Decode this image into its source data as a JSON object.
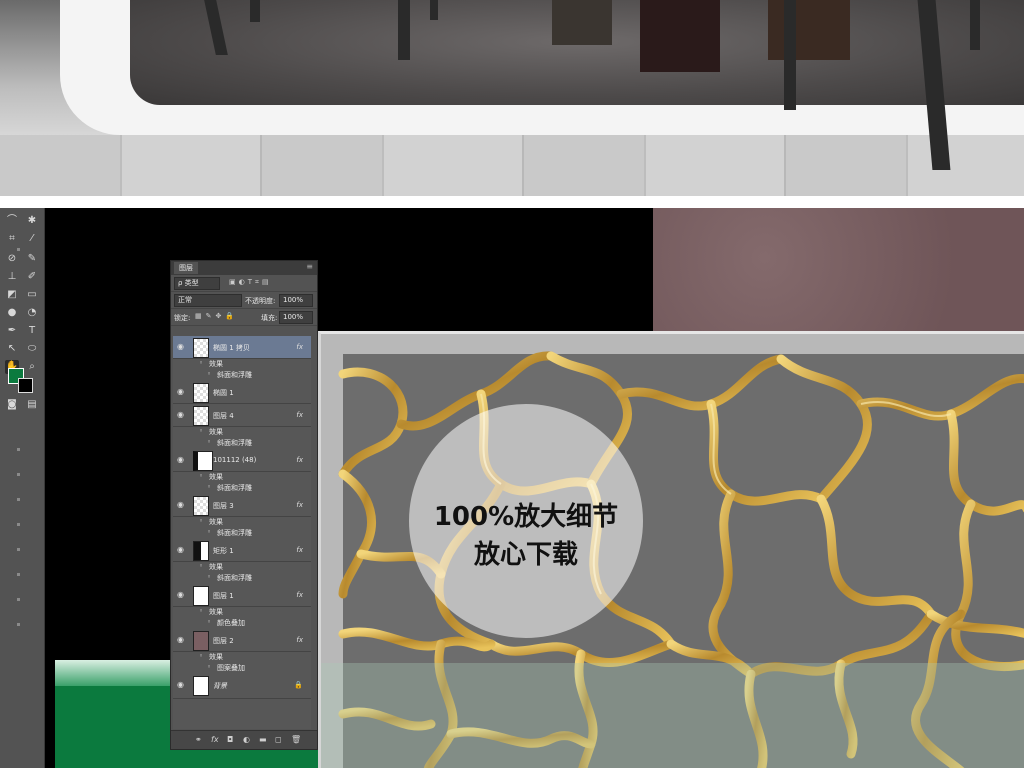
{
  "zoom_callout": {
    "line1": "100%放大细节",
    "line2": "放心下载"
  },
  "layers_panel": {
    "tab_title": "图层",
    "filter_label": "ρ 类型",
    "blend_mode": "正常",
    "opacity_label": "不透明度:",
    "opacity_value": "100%",
    "lock_label": "锁定:",
    "fill_label": "填充:",
    "fill_value": "100%",
    "layers": [
      {
        "name": "椭圆 1 拷贝",
        "fx": "fx",
        "effects_label": "效果",
        "effect": "斜面和浮雕",
        "selected": true
      },
      {
        "name": "椭圆 1"
      },
      {
        "name": "图层 4",
        "fx": "fx",
        "effects_label": "效果",
        "effect": "斜面和浮雕"
      },
      {
        "name": "101112 (48)",
        "fx": "fx",
        "effects_label": "效果",
        "effect": "斜面和浮雕"
      },
      {
        "name": "图层 3",
        "fx": "fx",
        "effects_label": "效果",
        "effect": "斜面和浮雕"
      },
      {
        "name": "矩形 1",
        "fx": "fx",
        "effects_label": "效果",
        "effect": "斜面和浮雕"
      },
      {
        "name": "图层 1",
        "fx": "fx",
        "effects_label": "效果",
        "effect": "颜色叠加"
      },
      {
        "name": "图层 2",
        "fx": "fx",
        "effects_label": "效果",
        "effect": "图案叠加"
      },
      {
        "name": "背景"
      }
    ],
    "footer_icons": [
      "link-icon",
      "fx-icon",
      "mask-icon",
      "adjustment-icon",
      "folder-icon",
      "new-layer-icon",
      "trash-icon"
    ]
  },
  "colors": {
    "foreground": "#0b7a3e",
    "background": "#000000",
    "mesh_gold": "#c9a24a",
    "mauve": "#7a5f62"
  }
}
